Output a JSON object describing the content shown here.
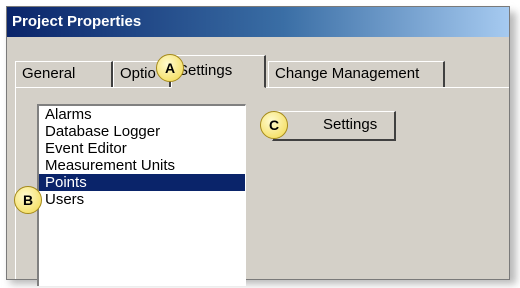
{
  "window": {
    "title": "Project Properties"
  },
  "tabs": [
    {
      "label": "General",
      "active": false
    },
    {
      "label": "Optio",
      "active": false
    },
    {
      "label": "Settings",
      "active": true
    },
    {
      "label": "Change Management",
      "active": false
    }
  ],
  "settings_list": {
    "items": [
      "Alarms",
      "Database Logger",
      "Event Editor",
      "Measurement Units",
      "Points",
      "Users"
    ],
    "selected": "Points"
  },
  "settings_button": {
    "label": "Settings"
  },
  "callouts": {
    "a": "A",
    "b": "B",
    "c": "C"
  },
  "colors": {
    "selection": "#0a246a",
    "title_gradient_start": "#0a246a",
    "title_gradient_end": "#a6caf0",
    "callout_fill": "#f2d84a",
    "dialog_face": "#d4d0c8"
  }
}
